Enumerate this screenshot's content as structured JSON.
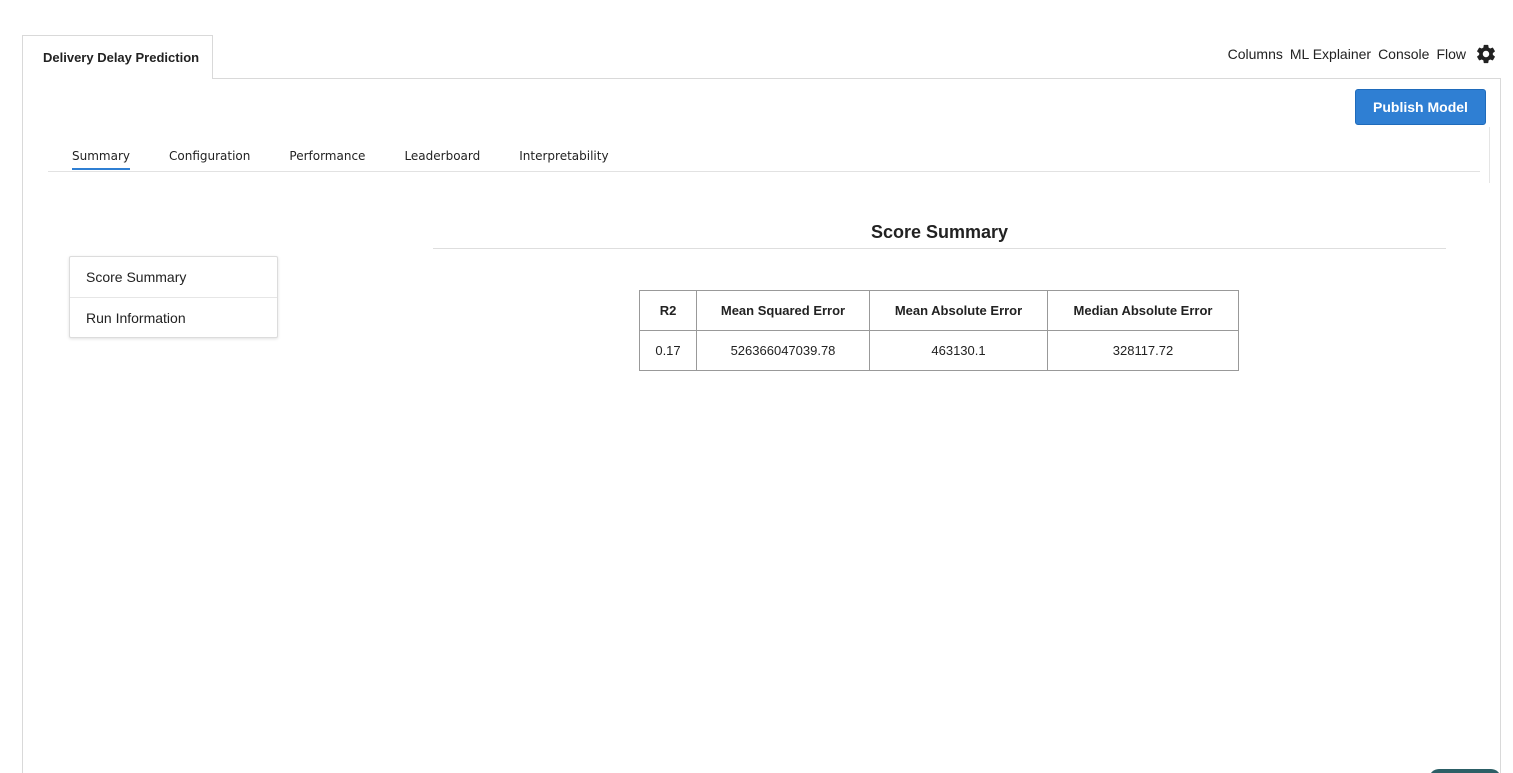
{
  "top_tab": {
    "label": "Delivery Delay Prediction"
  },
  "top_nav": {
    "columns": "Columns",
    "ml_explainer": "ML Explainer",
    "console": "Console",
    "flow": "Flow"
  },
  "publish_label": "Publish Model",
  "tabs": [
    {
      "label": "Summary",
      "active": true
    },
    {
      "label": "Configuration"
    },
    {
      "label": "Performance"
    },
    {
      "label": "Leaderboard"
    },
    {
      "label": "Interpretability"
    }
  ],
  "side_menu": [
    "Score Summary",
    "Run Information"
  ],
  "score_summary": {
    "title": "Score Summary",
    "headers": [
      "R2",
      "Mean Squared Error",
      "Mean Absolute Error",
      "Median Absolute Error"
    ],
    "row": [
      "0.17",
      "526366047039.78",
      "463130.1",
      "328117.72"
    ]
  },
  "colors": {
    "accent": "#2f7fd3"
  },
  "icons": {
    "settings": "gear-icon"
  }
}
